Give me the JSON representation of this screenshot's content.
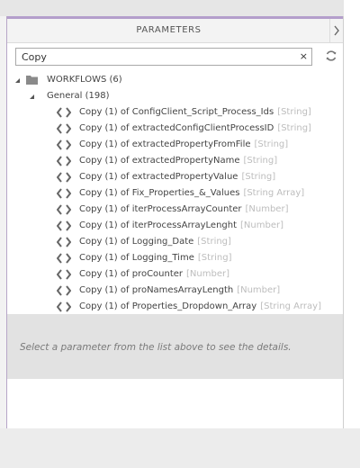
{
  "header": {
    "title": "PARAMETERS"
  },
  "search": {
    "value": "Copy",
    "clear_glyph": "×"
  },
  "tree": {
    "workflows": {
      "label": "WORKFLOWS (6)"
    },
    "general": {
      "label": "General (198)"
    }
  },
  "params": [
    {
      "name": "Copy (1) of ConfigClient_Script_Process_Ids",
      "type": "[String]"
    },
    {
      "name": "Copy (1) of extractedConfigClientProcessID",
      "type": "[String]"
    },
    {
      "name": "Copy (1) of extractedPropertyFromFile",
      "type": "[String]"
    },
    {
      "name": "Copy (1) of extractedPropertyName",
      "type": "[String]"
    },
    {
      "name": "Copy (1) of extractedPropertyValue",
      "type": "[String]"
    },
    {
      "name": "Copy (1) of Fix_Properties_&_Values",
      "type": "[String Array]"
    },
    {
      "name": "Copy (1) of iterProcessArrayCounter",
      "type": "[Number]"
    },
    {
      "name": "Copy (1) of iterProcessArrayLenght",
      "type": "[Number]"
    },
    {
      "name": "Copy (1) of Logging_Date",
      "type": "[String]"
    },
    {
      "name": "Copy (1) of Logging_Time",
      "type": "[String]"
    },
    {
      "name": "Copy (1) of proCounter",
      "type": "[Number]"
    },
    {
      "name": "Copy (1) of proNamesArrayLength",
      "type": "[Number]"
    },
    {
      "name": "Copy (1) of Properties_Dropdown_Array",
      "type": "[String Array]"
    }
  ],
  "details": {
    "hint": "Select a parameter from the list above to see the details."
  },
  "colors": {
    "accent": "#b49ecb",
    "type_text": "#bdbdbd",
    "details_bg": "#e2e2e2"
  }
}
